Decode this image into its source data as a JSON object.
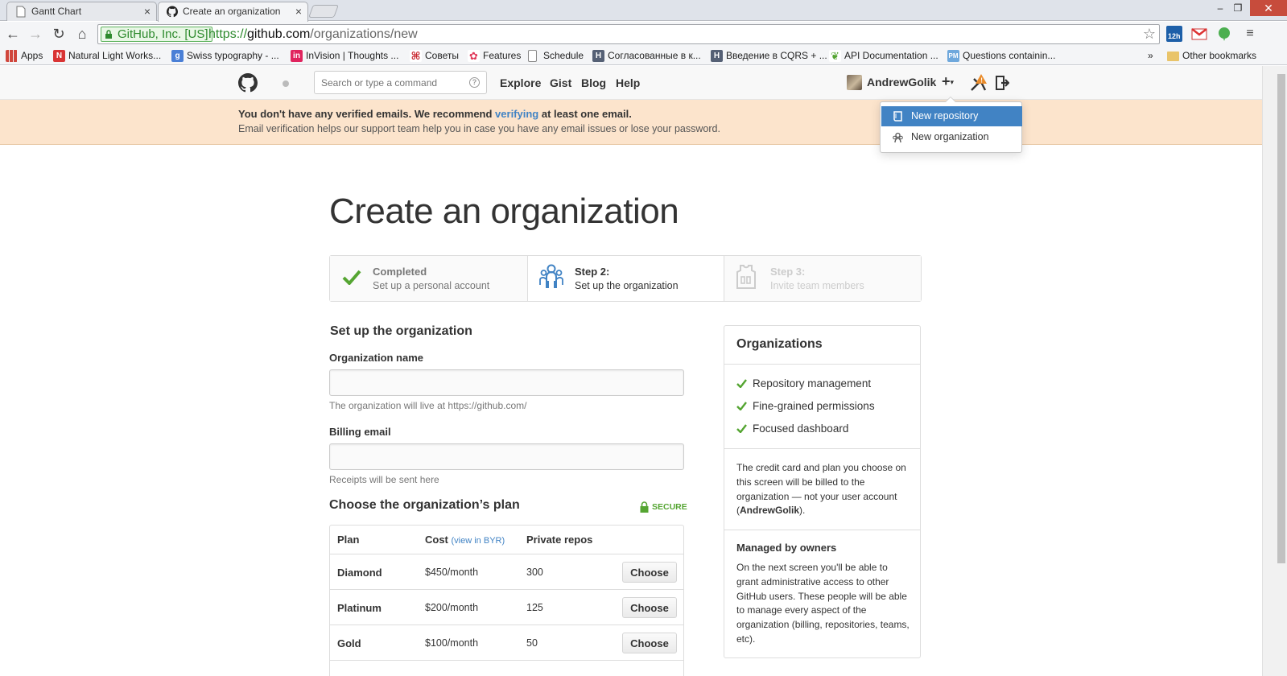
{
  "browser": {
    "tabs": [
      {
        "label": "Gantt Chart",
        "close": "×"
      },
      {
        "label": "Create an organization",
        "close": "×"
      }
    ],
    "window_controls": {
      "minimize": "–",
      "maximize": "❐",
      "close": "✕"
    },
    "ev_label": "GitHub, Inc. [US]",
    "url_scheme": "https://",
    "url_host": "github.com",
    "url_path": "/organizations/new",
    "star": "☆",
    "ext_badge": "12h",
    "bookmarks": [
      {
        "label": "Apps",
        "icon": "apps-grid-icon",
        "color": "#d0463c"
      },
      {
        "label": "Natural Light Works...",
        "icon": "natural-light-icon",
        "color": "#d93434"
      },
      {
        "label": "Swiss typography - ...",
        "icon": "google-g-icon",
        "color": "#4a7fd6"
      },
      {
        "label": "InVision | Thoughts ...",
        "icon": "invision-icon",
        "color": "#e0245e"
      },
      {
        "label": "Советы",
        "icon": "tips-icon",
        "color": "#c8262d"
      },
      {
        "label": "Features",
        "icon": "features-icon",
        "color": "#e03a5a"
      },
      {
        "label": "Schedule",
        "icon": "page-icon",
        "color": "#ffffff"
      },
      {
        "label": "Согласованные в к...",
        "icon": "h-icon",
        "color": "#556075"
      },
      {
        "label": "Введение в CQRS + ...",
        "icon": "h-icon",
        "color": "#556075"
      },
      {
        "label": "API Documentation ...",
        "icon": "leaf-icon",
        "color": "#55a532"
      },
      {
        "label": "Questions containin...",
        "icon": "pm-icon",
        "color": "#6fa8dc"
      }
    ],
    "bookmarks_overflow": "»",
    "other_bookmarks": "Other bookmarks"
  },
  "header": {
    "search_placeholder": "Search or type a command",
    "search_help": "?",
    "nav": [
      "Explore",
      "Gist",
      "Blog",
      "Help"
    ],
    "username": "AndrewGolik",
    "plus": "+",
    "caret": "▾"
  },
  "flash": {
    "line1_before": "You don't have any verified emails. We recommend ",
    "line1_link": "verifying",
    "line1_after": " at least one email.",
    "line2": "Email verification helps our support team help you in case you have any email issues or lose your password."
  },
  "dropdown": {
    "items": [
      {
        "label": "New repository",
        "active": true
      },
      {
        "label": "New organization",
        "active": false
      }
    ]
  },
  "page": {
    "title": "Create an organization",
    "steps": [
      {
        "title": "Completed",
        "subtitle": "Set up a personal account",
        "state": "completed"
      },
      {
        "title": "Step 2:",
        "subtitle": "Set up the organization",
        "state": "current"
      },
      {
        "title": "Step 3:",
        "subtitle": "Invite team members",
        "state": "upcoming"
      }
    ],
    "form": {
      "section_title": "Set up the organization",
      "org_name_label": "Organization name",
      "org_name_value": "",
      "org_name_note": "The organization will live at https://github.com/",
      "billing_label": "Billing email",
      "billing_value": "",
      "billing_note": "Receipts will be sent here"
    },
    "plans": {
      "title": "Choose the organization’s plan",
      "secure": "SECURE",
      "headers": {
        "plan": "Plan",
        "cost": "Cost",
        "cost_link": "(view in BYR)",
        "repos": "Private repos"
      },
      "rows": [
        {
          "name": "Diamond",
          "cost": "$450/month",
          "repos": "300",
          "button": "Choose"
        },
        {
          "name": "Platinum",
          "cost": "$200/month",
          "repos": "125",
          "button": "Choose"
        },
        {
          "name": "Gold",
          "cost": "$100/month",
          "repos": "50",
          "button": "Choose"
        }
      ]
    },
    "sidebar": {
      "title": "Organizations",
      "features": [
        "Repository management",
        "Fine-grained permissions",
        "Focused dashboard"
      ],
      "billing_before": "The credit card and plan you choose on this screen will be billed to the organization — not your user account (",
      "billing_user": "AndrewGolik",
      "billing_after": ").",
      "owners_title": "Managed by owners",
      "owners_text": "On the next screen you'll be able to grant administrative access to other GitHub users. These people will be able to manage every aspect of the organization (billing, repositories, teams, etc)."
    }
  },
  "colors": {
    "link": "#4183c4",
    "success": "#55a532",
    "flash_bg": "#fce4cc",
    "dropdown_active": "#4183c4"
  }
}
